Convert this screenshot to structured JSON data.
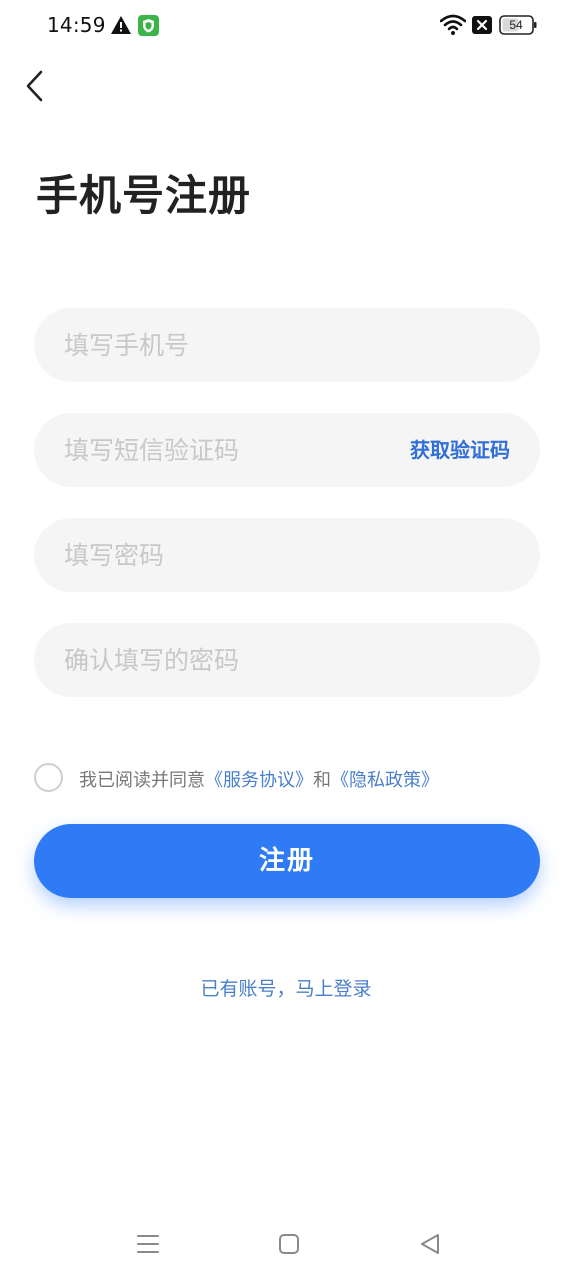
{
  "status_bar": {
    "time": "14:59",
    "battery": "54",
    "icons": [
      "warning-icon",
      "shield-icon",
      "wifi-icon",
      "sim-off-icon",
      "battery-icon"
    ]
  },
  "header": {
    "back_icon": "chevron-left-icon",
    "title": "手机号注册"
  },
  "form": {
    "phone_placeholder": "填写手机号",
    "phone_value": "",
    "code_placeholder": "填写短信验证码",
    "code_value": "",
    "get_code_label": "获取验证码",
    "password_placeholder": "填写密码",
    "password_value": "",
    "confirm_placeholder": "确认填写的密码",
    "confirm_value": ""
  },
  "agreement": {
    "checked": false,
    "prefix": "我已阅读并同意",
    "service_link": "《服务协议》",
    "conjunction": "和",
    "privacy_link": "《隐私政策》"
  },
  "actions": {
    "register_label": "注册",
    "login_link": "已有账号，马上登录"
  },
  "nav_bar": {
    "icons": [
      "menu-icon",
      "home-icon",
      "back-triangle-icon"
    ]
  },
  "colors": {
    "accent": "#2f7af5",
    "link": "#4a7fcc",
    "field_bg": "#f5f5f5",
    "placeholder": "#c8c8c8"
  }
}
